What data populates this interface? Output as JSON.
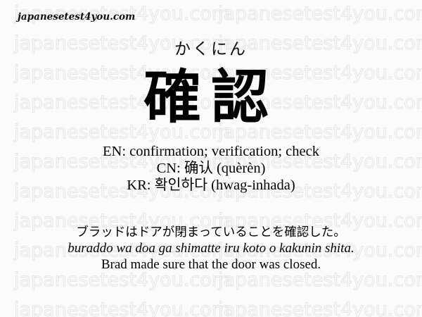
{
  "site": "japanesetest4you.com",
  "watermark_text": "japanesetest4you.com",
  "reading": "かくにん",
  "kanji": "確認",
  "definitions": {
    "en": "EN: confirmation; verification; check",
    "cn": "CN: 确认 (quèrèn)",
    "kr": "KR: 확인하다 (hwag-inhada)"
  },
  "example": {
    "japanese": "ブラッドはドアが閉まっていることを確認した。",
    "romaji": "buraddo wa doa ga shimatte iru koto o kakunin shita.",
    "english": "Brad made sure that the door was closed."
  },
  "colors": {
    "background": "#fbfbfb",
    "watermark": "#e6e6e6",
    "text": "#000000"
  }
}
